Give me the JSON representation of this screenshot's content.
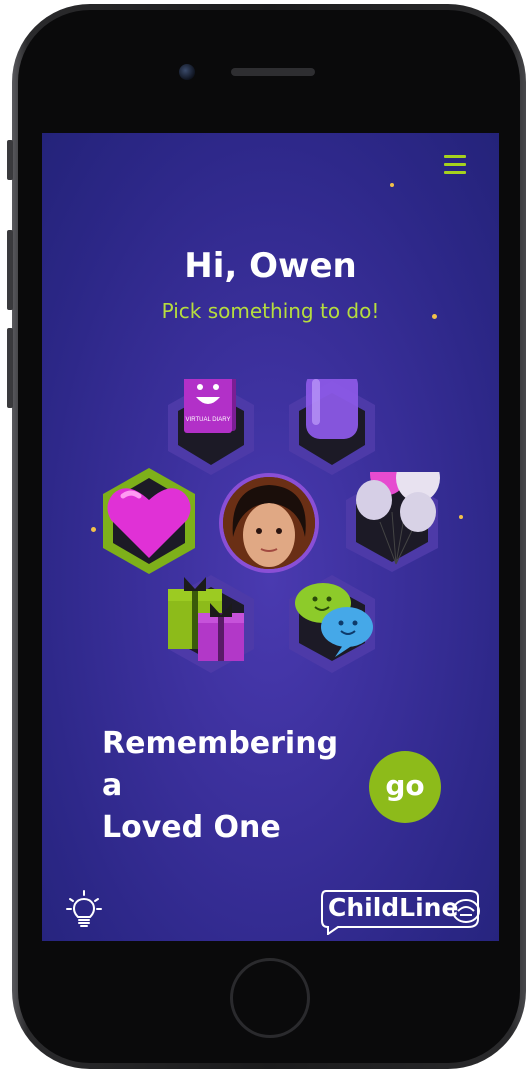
{
  "header": {
    "greeting": "Hi, Owen",
    "subtitle": "Pick something to do!",
    "menu_icon": "hamburger-menu-icon"
  },
  "activities": [
    {
      "name": "virtual-diary",
      "label": "VIRTUAL DIARY",
      "icon": "diary-book-icon",
      "selected": false
    },
    {
      "name": "jar",
      "icon": "jar-icon",
      "selected": false
    },
    {
      "name": "heart",
      "icon": "heart-icon",
      "selected": true
    },
    {
      "name": "balloons",
      "icon": "balloons-icon",
      "selected": false
    },
    {
      "name": "gifts",
      "icon": "gift-box-icon",
      "selected": false
    },
    {
      "name": "chat",
      "icon": "chat-bubbles-icon",
      "selected": false
    }
  ],
  "profile": {
    "icon": "profile-photo"
  },
  "activity": {
    "title_line1": "Remembering a",
    "title_line2": "Loved One",
    "go_label": "go"
  },
  "footer": {
    "tip_icon": "lightbulb-icon",
    "logo_text": "ChildLine"
  },
  "colors": {
    "background": "#2c2787",
    "accent_green": "#8dbb1a",
    "subtitle_green": "#b6dd3e",
    "hex_dark": "#1c1a26",
    "hex_ring": "#4d3aa8"
  }
}
